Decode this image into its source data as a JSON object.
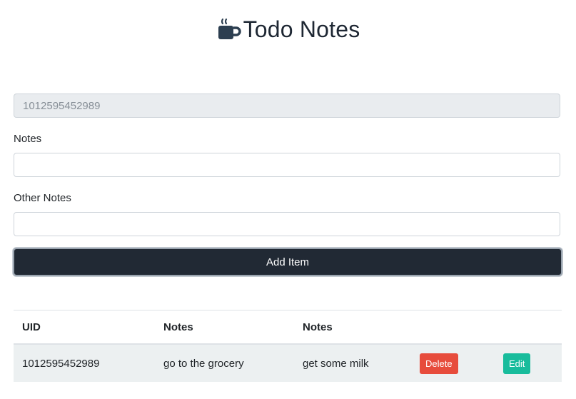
{
  "header": {
    "title": "Todo Notes",
    "logo_icon": "coffee-mug-icon",
    "icon_color": "#2c3e50"
  },
  "form": {
    "uid_value": "1012595452989",
    "notes_label": "Notes",
    "notes_value": "",
    "other_notes_label": "Other Notes",
    "other_notes_value": "",
    "add_button_label": "Add Item"
  },
  "table": {
    "headers": [
      "UID",
      "Notes",
      "Notes",
      "",
      ""
    ],
    "rows": [
      {
        "uid": "1012595452989",
        "notes": "go to the grocery",
        "other_notes": "get some milk",
        "delete_label": "Delete",
        "edit_label": "Edit"
      }
    ]
  },
  "colors": {
    "primary_dark": "#212934",
    "danger": "#e74c3c",
    "success": "#18bc9c",
    "row_bg": "#ecf0f1"
  }
}
